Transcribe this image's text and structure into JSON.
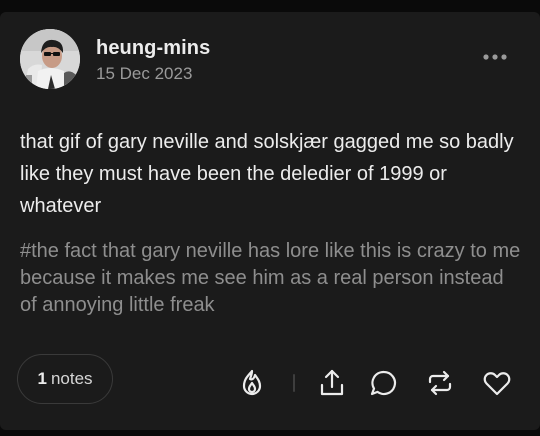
{
  "post": {
    "username": "heung-mins",
    "date": "15 Dec 2023",
    "body": "that gif of gary neville and solskjær gagged me so badly like they must have been the deledier of 1999 or whatever",
    "tags": "#the fact that gary neville has lore like this is crazy to me because it makes me see him as a real person instead of annoying little freak"
  },
  "footer": {
    "notes_count": "1",
    "notes_label": "notes"
  },
  "icons": {
    "more": "more-horizontal-icon",
    "blaze": "flame-icon",
    "share": "share-icon",
    "reply": "reply-bubble-icon",
    "reblog": "reblog-icon",
    "like": "heart-icon"
  },
  "colors": {
    "card_background": "#1b1b1b",
    "text_primary": "#ececec",
    "text_secondary": "#8e8e8e"
  }
}
